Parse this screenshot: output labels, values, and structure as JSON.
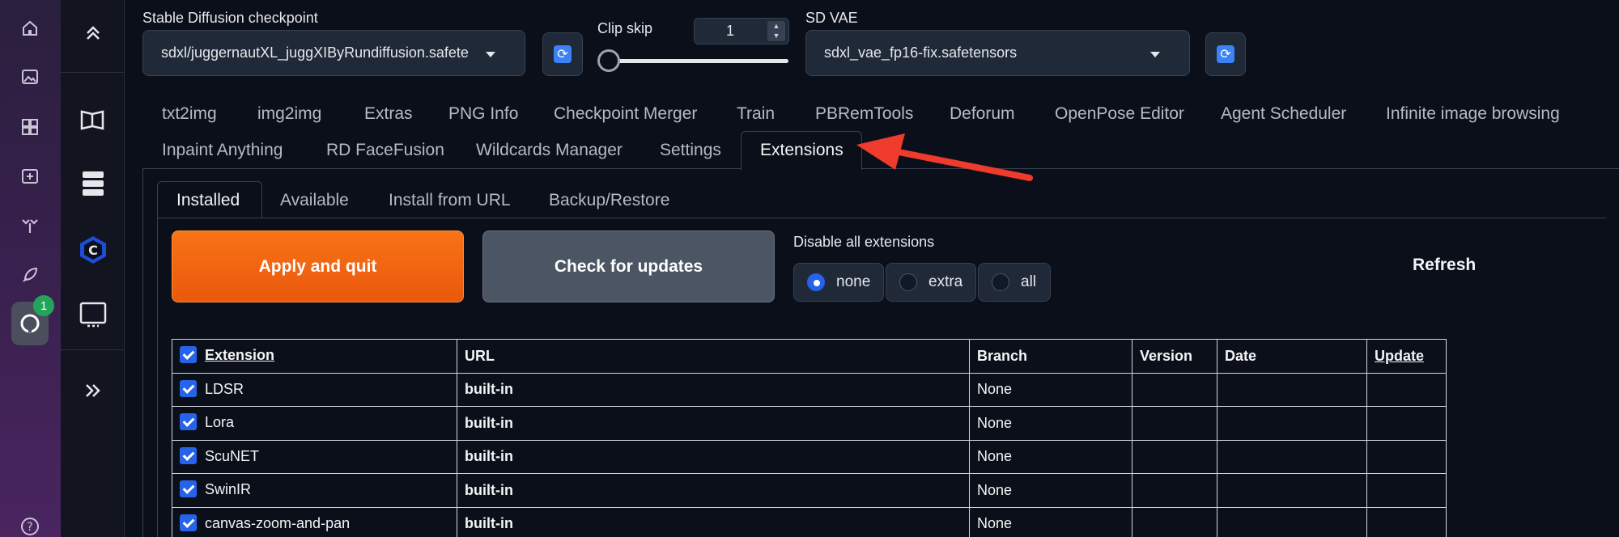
{
  "rail": {
    "icons": [
      "home-icon",
      "image-icon",
      "dashboard-icon",
      "add-image-icon",
      "gym-icon",
      "rocket-icon",
      "github-icon",
      "help-icon"
    ],
    "badge": "1"
  },
  "col2": {
    "icons": [
      "chevrons-up-icon",
      "book-icon",
      "server-icon",
      "civitai-icon",
      "monitor-icon",
      "chevrons-right-icon"
    ]
  },
  "top": {
    "checkpoint_label": "Stable Diffusion checkpoint",
    "checkpoint_value": "sdxl/juggernautXL_juggXIByRundiffusion.safete",
    "clip_skip_label": "Clip skip",
    "clip_skip_value": "1",
    "clip_skip_level": 0.0,
    "vae_label": "SD VAE",
    "vae_value": "sdxl_vae_fp16-fix.safetensors"
  },
  "tabs_row1": [
    "txt2img",
    "img2img",
    "Extras",
    "PNG Info",
    "Checkpoint Merger",
    "Train",
    "PBRemTools",
    "Deforum",
    "OpenPose Editor",
    "Agent Scheduler",
    "Infinite image browsing"
  ],
  "tabs_row2": [
    "Inpaint Anything",
    "RD FaceFusion",
    "Wildcards Manager",
    "Settings",
    "Extensions"
  ],
  "active_tab": "Extensions",
  "subtabs": [
    "Installed",
    "Available",
    "Install from URL",
    "Backup/Restore"
  ],
  "active_subtab": "Installed",
  "actions": {
    "apply": "Apply and quit",
    "check": "Check for updates",
    "disable_label": "Disable all extensions",
    "radio_none": "none",
    "radio_extra": "extra",
    "radio_all": "all",
    "refresh": "Refresh"
  },
  "table": {
    "headers": [
      "Extension",
      "URL",
      "Branch",
      "Version",
      "Date",
      "Update"
    ],
    "rows": [
      {
        "name": "LDSR",
        "url": "built-in",
        "branch": "None"
      },
      {
        "name": "Lora",
        "url": "built-in",
        "branch": "None"
      },
      {
        "name": "ScuNET",
        "url": "built-in",
        "branch": "None"
      },
      {
        "name": "SwinIR",
        "url": "built-in",
        "branch": "None"
      },
      {
        "name": "canvas-zoom-and-pan",
        "url": "built-in",
        "branch": "None"
      }
    ]
  },
  "colors": {
    "accent_orange": "#ea580c",
    "accent_blue": "#2563eb",
    "annotation_arrow": "#ef3b2c"
  }
}
